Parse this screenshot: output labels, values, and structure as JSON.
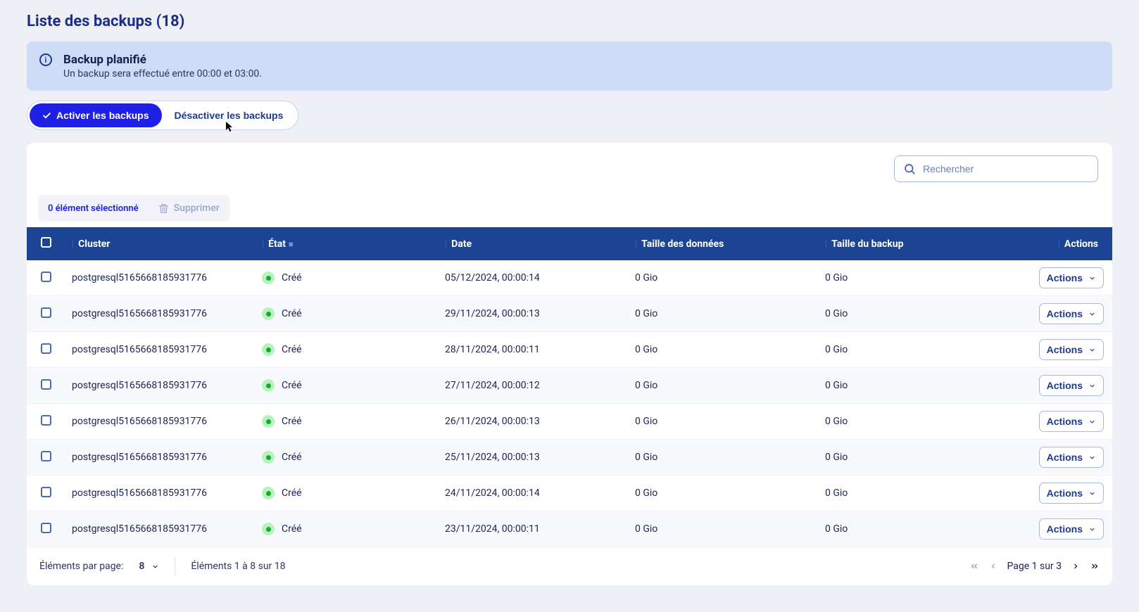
{
  "page": {
    "title": "Liste des backups (18)"
  },
  "banner": {
    "title": "Backup planifié",
    "text": "Un backup sera effectué entre 00:00 et 03:00."
  },
  "toggles": {
    "enable": "Activer les backups",
    "disable": "Désactiver les backups"
  },
  "search": {
    "placeholder": "Rechercher"
  },
  "selection": {
    "count_label": "0 élément sélectionné",
    "delete_label": "Supprimer"
  },
  "columns": {
    "cluster": "Cluster",
    "state": "État",
    "date": "Date",
    "data_size": "Taille des données",
    "backup_size": "Taille du backup",
    "actions": "Actions"
  },
  "row_actions_label": "Actions",
  "rows": [
    {
      "cluster": "postgresql5165668185931776",
      "state": "Créé",
      "date": "05/12/2024, 00:00:14",
      "data_size": "0 Gio",
      "backup_size": "0 Gio"
    },
    {
      "cluster": "postgresql5165668185931776",
      "state": "Créé",
      "date": "29/11/2024, 00:00:13",
      "data_size": "0 Gio",
      "backup_size": "0 Gio"
    },
    {
      "cluster": "postgresql5165668185931776",
      "state": "Créé",
      "date": "28/11/2024, 00:00:11",
      "data_size": "0 Gio",
      "backup_size": "0 Gio"
    },
    {
      "cluster": "postgresql5165668185931776",
      "state": "Créé",
      "date": "27/11/2024, 00:00:12",
      "data_size": "0 Gio",
      "backup_size": "0 Gio"
    },
    {
      "cluster": "postgresql5165668185931776",
      "state": "Créé",
      "date": "26/11/2024, 00:00:13",
      "data_size": "0 Gio",
      "backup_size": "0 Gio"
    },
    {
      "cluster": "postgresql5165668185931776",
      "state": "Créé",
      "date": "25/11/2024, 00:00:13",
      "data_size": "0 Gio",
      "backup_size": "0 Gio"
    },
    {
      "cluster": "postgresql5165668185931776",
      "state": "Créé",
      "date": "24/11/2024, 00:00:14",
      "data_size": "0 Gio",
      "backup_size": "0 Gio"
    },
    {
      "cluster": "postgresql5165668185931776",
      "state": "Créé",
      "date": "23/11/2024, 00:00:11",
      "data_size": "0 Gio",
      "backup_size": "0 Gio"
    }
  ],
  "footer": {
    "per_page_label": "Éléments par page:",
    "per_page_value": "8",
    "range": "Éléments 1 à 8 sur 18",
    "page_label": "Page 1 sur 3"
  }
}
